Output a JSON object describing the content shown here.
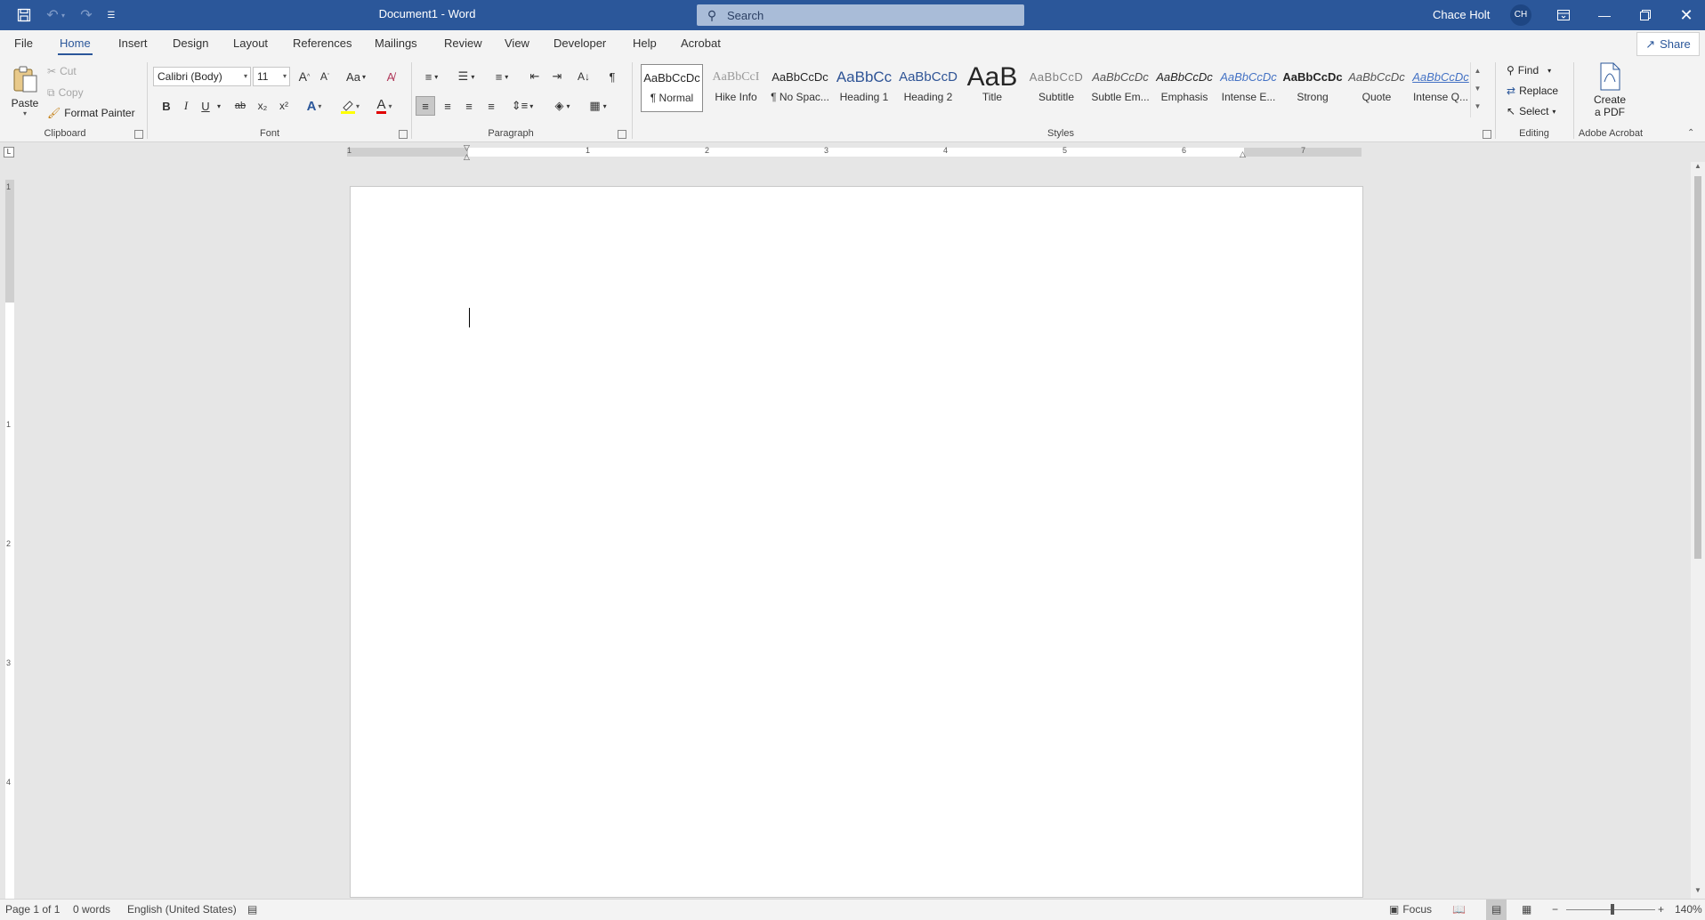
{
  "titlebar": {
    "title": "Document1  -  Word",
    "search_placeholder": "Search",
    "user_name": "Chace Holt",
    "user_initials": "CH"
  },
  "tabs": [
    "File",
    "Home",
    "Insert",
    "Design",
    "Layout",
    "References",
    "Mailings",
    "Review",
    "View",
    "Developer",
    "Help",
    "Acrobat"
  ],
  "share_label": "Share",
  "clipboard": {
    "paste": "Paste",
    "cut": "Cut",
    "copy": "Copy",
    "format_painter": "Format Painter",
    "group": "Clipboard"
  },
  "font": {
    "family": "Calibri (Body)",
    "size": "11",
    "change_case": "Aa",
    "grow": "A",
    "shrink": "A",
    "bold": "B",
    "italic": "I",
    "underline": "U",
    "strike": "ab",
    "subscript": "x₂",
    "superscript": "x²",
    "group": "Font"
  },
  "paragraph": {
    "show_marks": "¶",
    "group": "Paragraph"
  },
  "styles": {
    "group": "Styles",
    "items": [
      {
        "preview": "AaBbCcDc",
        "name": "¶ Normal"
      },
      {
        "preview": "AaBbCcI",
        "name": "Hike Info"
      },
      {
        "preview": "AaBbCcDc",
        "name": "¶ No Spac..."
      },
      {
        "preview": "AaBbCc",
        "name": "Heading 1"
      },
      {
        "preview": "AaBbCcD",
        "name": "Heading 2"
      },
      {
        "preview": "AaB",
        "name": "Title"
      },
      {
        "preview": "AaBbCcD",
        "name": "Subtitle"
      },
      {
        "preview": "AaBbCcDc",
        "name": "Subtle Em..."
      },
      {
        "preview": "AaBbCcDc",
        "name": "Emphasis"
      },
      {
        "preview": "AaBbCcDc",
        "name": "Intense E..."
      },
      {
        "preview": "AaBbCcDc",
        "name": "Strong"
      },
      {
        "preview": "AaBbCcDc",
        "name": "Quote"
      },
      {
        "preview": "AaBbCcDc",
        "name": "Intense Q..."
      }
    ]
  },
  "editing": {
    "find": "Find",
    "replace": "Replace",
    "select": "Select",
    "group": "Editing"
  },
  "acrobat": {
    "create_line1": "Create",
    "create_line2": "a PDF",
    "group": "Adobe Acrobat"
  },
  "ruler": {
    "h_numbers": [
      "1",
      "1",
      "2",
      "3",
      "4",
      "5",
      "6",
      "7"
    ],
    "v_numbers": [
      "1",
      "1",
      "2",
      "3",
      "4"
    ]
  },
  "statusbar": {
    "page": "Page 1 of 1",
    "words": "0 words",
    "language": "English (United States)",
    "focus": "Focus",
    "zoom_minus": "−",
    "zoom_plus": "+",
    "zoom": "140%"
  },
  "colors": {
    "brand": "#2b579a",
    "highlight": "#ffff00",
    "font_color": "#e00000"
  }
}
